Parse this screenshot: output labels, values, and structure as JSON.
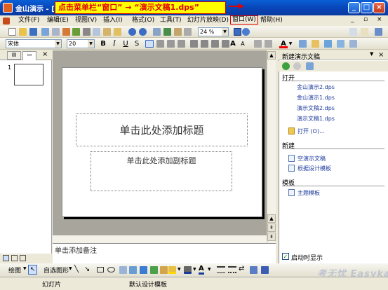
{
  "window": {
    "app_title": "金山演示 - [",
    "instruction_banner": "点击菜单栏“窗口” → “演示文稿1.dps”",
    "min_label": "_",
    "max_label": "□",
    "close_label": "×"
  },
  "menu": [
    "文件(F)",
    "编辑(E)",
    "视图(V)",
    "插入(I)",
    "格式(O)",
    "工具(T)",
    "幻灯片放映(D)",
    "窗口(W)",
    "帮助(H)"
  ],
  "toolbar": {
    "zoom": "24 %",
    "font_name": "宋体",
    "font_size": "20",
    "bold": "B",
    "italic": "I",
    "underline": "U",
    "strike": "S"
  },
  "left_pane": {
    "slide_number": "1"
  },
  "slide": {
    "title_placeholder": "单击此处添加标题",
    "subtitle_placeholder": "单击此处添加副标题"
  },
  "notes_placeholder": "单击添加备注",
  "task_pane": {
    "title": "新建演示文稿",
    "open_section": "打开",
    "recent_files": [
      "金山演示2.dps",
      "金山演示1.dps",
      "演示文稿2.dps",
      "演示文稿1.dps"
    ],
    "open_more": "打开 (O)...",
    "new_section": "新建",
    "new_items": [
      "空演示文稿",
      "根据设计模板"
    ],
    "template_section": "模板",
    "template_items": [
      "主题模板"
    ],
    "startup_label": "启动时显示"
  },
  "drawing_toolbar": {
    "draw_label": "绘图",
    "autoshapes_label": "自选图形"
  },
  "status_bar": {
    "slide_label": "幻灯片",
    "design_label": "默认设计模板"
  },
  "watermark": "考无忧 Easykao"
}
